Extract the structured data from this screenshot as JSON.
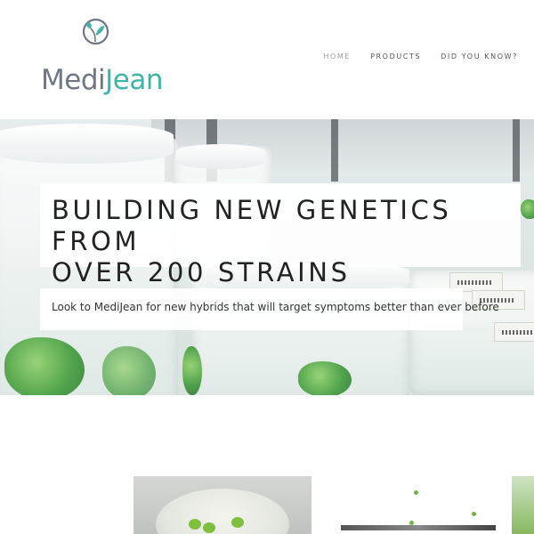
{
  "brand": {
    "name_part1": "Medi",
    "name_part2": "Jean",
    "emblem": "leaf-icon",
    "colors": {
      "gray": "#6e7885",
      "teal": "#3fb5a8"
    }
  },
  "nav": {
    "items": [
      {
        "label": "HOME",
        "active": true
      },
      {
        "label": "PRODUCTS",
        "active": false
      },
      {
        "label": "DID YOU KNOW?",
        "active": false
      }
    ]
  },
  "hero": {
    "title_line1": "BUILDING NEW GENETICS FROM",
    "title_line2": "OVER 200 STRAINS",
    "subtitle": "Look to MediJean for new hybrids that will target symptoms better than ever before"
  }
}
